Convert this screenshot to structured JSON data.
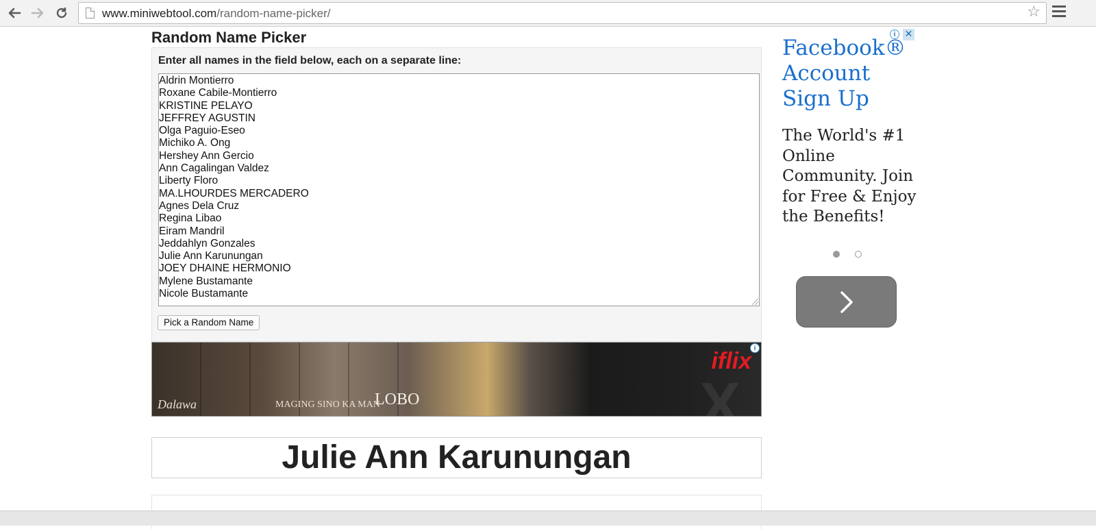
{
  "browser": {
    "url_host": "www.miniwebtool.com",
    "url_path": "/random-name-picker/",
    "back_icon": "back-arrow-icon",
    "forward_icon": "forward-arrow-icon",
    "reload_icon": "reload-icon",
    "bookmark_icon": "star-icon",
    "menu_icon": "hamburger-menu-icon"
  },
  "page": {
    "title": "Random Name Picker",
    "instruction": "Enter all names in the field below, each on a separate line:",
    "names": [
      "Aldrin Montierro",
      "Roxane Cabile-Montierro",
      "KRISTINE PELAYO",
      "JEFFREY AGUSTIN",
      "Olga Paguio-Eseo",
      "Michiko A. Ong",
      "Hershey Ann Gercio",
      "Ann Cagalingan Valdez",
      "Liberty Floro",
      "MA.LHOURDES MERCADERO",
      "Agnes Dela Cruz",
      "Regina Libao",
      "Eiram Mandril",
      "Jeddahlyn Gonzales",
      "Julie Ann Karunungan",
      "JOEY DHAINE HERMONIO",
      "Mylene Bustamante",
      "Nicole Bustamante"
    ],
    "pick_button": "Pick a Random Name",
    "result": "Julie Ann Karunungan"
  },
  "banner_ad": {
    "brand": "iflix",
    "caption_1": "Dalawa",
    "caption_2": "MAGING SINO KA MAN",
    "caption_3": "LOBO",
    "info_icon": "ad-info-icon"
  },
  "side_ad": {
    "title": "Facebook® Account Sign Up",
    "body": "The World's #1 Online Community. Join for Free & Enjoy the Benefits!",
    "close_glyph": "✕",
    "next_icon": "chevron-right-icon",
    "carousel_dots": 2,
    "active_dot": 0
  },
  "colors": {
    "link_blue": "#1a6fcc",
    "brand_red": "#e31b23",
    "ad_button_gray": "#7a7a7a"
  }
}
